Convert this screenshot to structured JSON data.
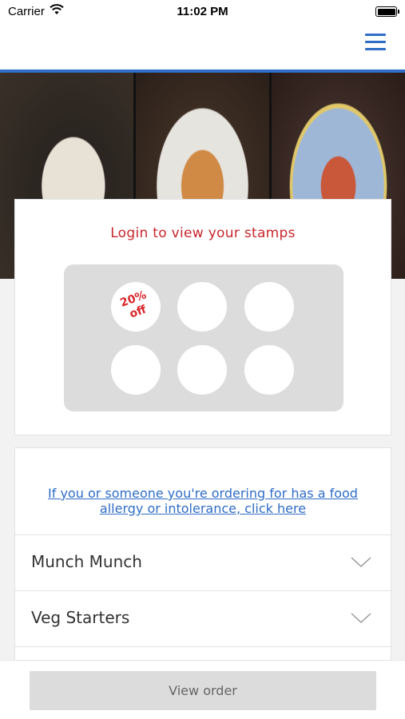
{
  "status_bar": {
    "carrier": "Carrier",
    "time": "11:02 PM",
    "icons": [
      "wifi-icon",
      "battery-icon"
    ]
  },
  "header": {
    "menu_icon": "hamburger-menu-icon",
    "accent_color": "#2f6dc6"
  },
  "loyalty": {
    "title": "Login to view your stamps",
    "title_color": "#c8262c",
    "stamps": [
      {
        "label": "20%\noff"
      },
      {
        "label": ""
      },
      {
        "label": ""
      },
      {
        "label": ""
      },
      {
        "label": ""
      },
      {
        "label": ""
      }
    ]
  },
  "allergy": {
    "link_text": "If you or someone you're ordering for has a food allergy or intolerance, click here"
  },
  "categories": [
    {
      "label": "Munch Munch"
    },
    {
      "label": "Veg Starters"
    },
    {
      "label": ""
    }
  ],
  "footer": {
    "view_order_label": "View order"
  }
}
